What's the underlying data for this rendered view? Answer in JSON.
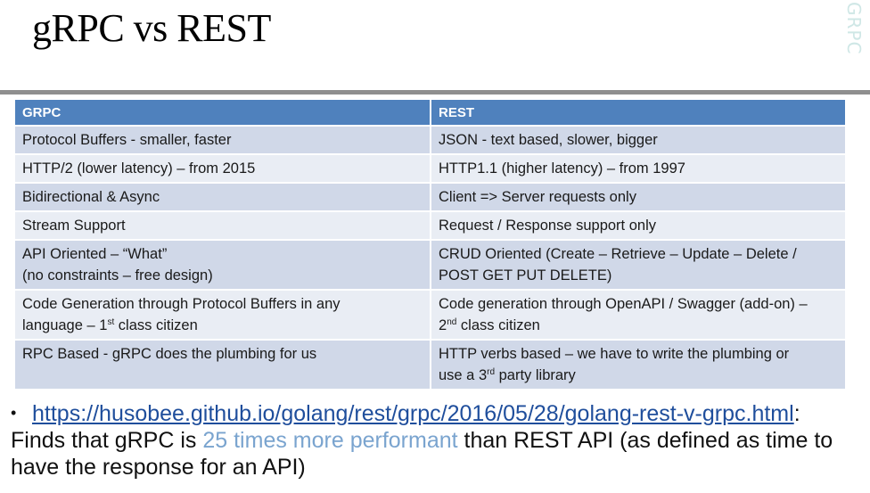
{
  "title": "gRPC vs REST",
  "brand": "GRPC",
  "table": {
    "headers": [
      "GRPC",
      "REST"
    ],
    "rows": [
      {
        "grpc": "Protocol Buffers - smaller, faster",
        "rest": "JSON - text based, slower, bigger"
      },
      {
        "grpc": "HTTP/2 (lower latency) – from 2015",
        "rest": "HTTP1.1 (higher latency) – from 1997"
      },
      {
        "grpc": "Bidirectional & Async",
        "rest": "Client => Server requests only"
      },
      {
        "grpc": "Stream Support",
        "rest": "Request / Response support only"
      },
      {
        "grpc": "API Oriented – “What”",
        "grpc_2": "(no constraints – free design)",
        "rest": "CRUD Oriented (Create – Retrieve – Update – Delete /",
        "rest_2": "POST GET PUT DELETE)"
      },
      {
        "grpc": "Code Generation through Protocol Buffers in any",
        "grpc_2a": "language – 1",
        "grpc_sup": "st",
        "grpc_2b": " class citizen",
        "rest": "Code generation through OpenAPI / Swagger (add-on) –",
        "rest_2a": "2",
        "rest_sup": "nd",
        "rest_2b": " class citizen"
      },
      {
        "grpc": "RPC Based - gRPC does the plumbing for us",
        "rest": "HTTP verbs based – we have to write the plumbing or",
        "rest_2a": "use a 3",
        "rest_sup": "rd",
        "rest_2b": " party library"
      }
    ]
  },
  "note": {
    "bullet": "•",
    "link": "https://husobee.github.io/golang/rest/grpc/2016/05/28/golang-rest-v-grpc.html",
    "text_a": ": Finds that gRPC is ",
    "highlight": "25 times more performant",
    "text_b": " than REST API (as defined as time to have the response for an API)"
  },
  "colors": {
    "header": "#4f81bd",
    "row_dark": "#d0d8e8",
    "row_light": "#e9edf4",
    "link": "#1f4e9c",
    "highlight": "#7aa4cf"
  }
}
